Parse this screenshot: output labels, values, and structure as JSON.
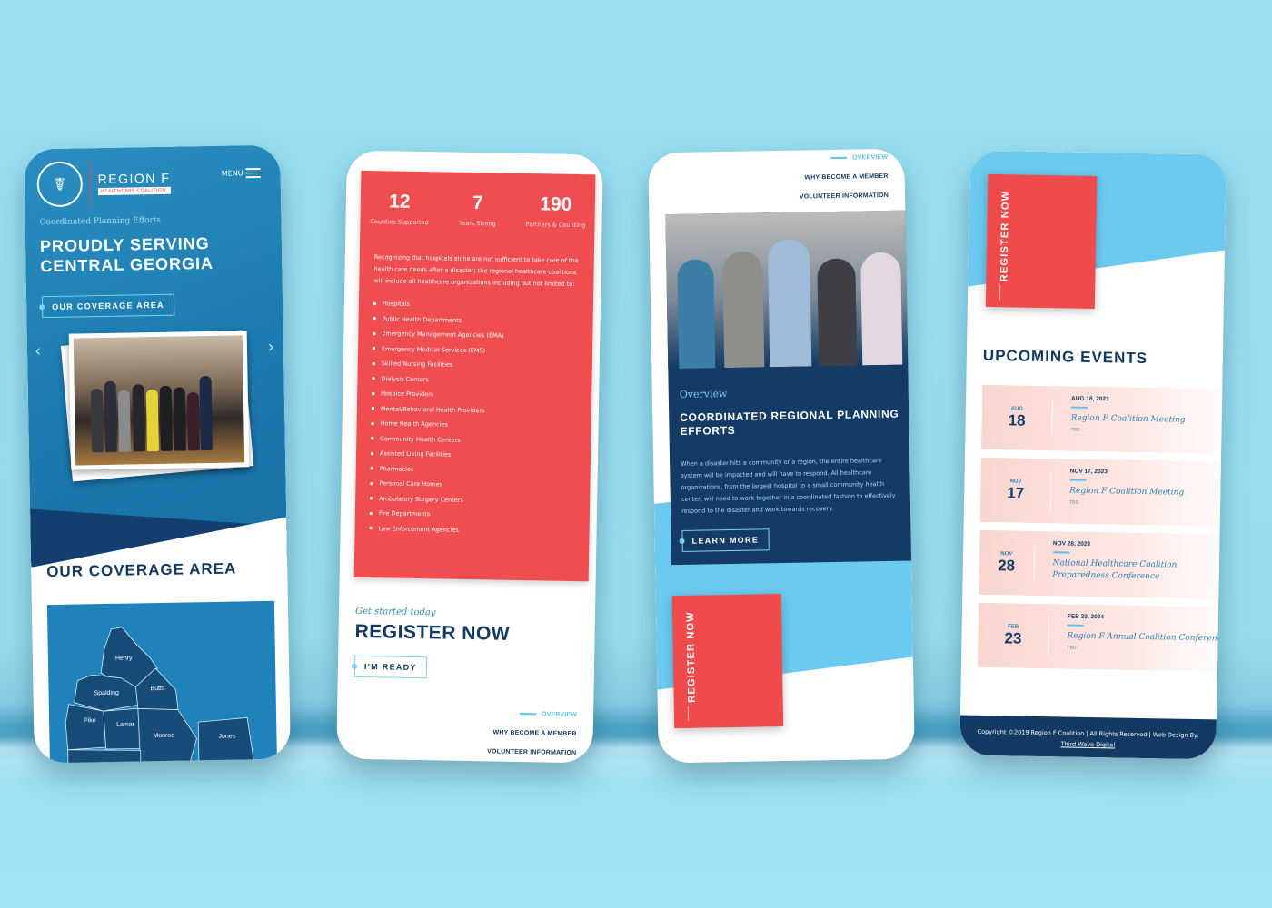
{
  "phone1": {
    "logo": {
      "title": "REGION F",
      "subtitle": "HEALTHCARE COALITION"
    },
    "menu_label": "MENU",
    "hero": {
      "eyebrow": "Coordinated Planning Efforts",
      "title_line1": "PROUDLY SERVING",
      "title_line2": "CENTRAL GEORGIA",
      "cta": "OUR COVERAGE AREA"
    },
    "carousel": {
      "prev": "‹",
      "next": "›"
    },
    "coverage": {
      "title": "OUR COVERAGE AREA",
      "counties": [
        "Henry",
        "Spalding",
        "Butts",
        "Pike",
        "Lamar",
        "Monroe",
        "Jones"
      ]
    }
  },
  "phone2": {
    "stats": [
      {
        "value": "12",
        "label": "Counties Supported"
      },
      {
        "value": "7",
        "label": "Years Strong"
      },
      {
        "value": "190",
        "label": "Partners & Counting"
      }
    ],
    "intro": "Recognizing that hospitals alone are not sufficient to take care of the health care needs after a disaster; the regional healthcare coalitions will include all healthcare organizations including but not limited to:",
    "organizations": [
      "Hospitals",
      "Public Health Departments",
      "Emergency Management Agencies (EMA)",
      "Emergency Medical Services (EMS)",
      "Skilled Nursing Facilities",
      "Dialysis Centers",
      "Hospice Providers",
      "Mental/Behavioral Health Providers",
      "Home Health Agencies",
      "Community Health Centers",
      "Assisted Living Facilities",
      "Pharmacies",
      "Personal Care Homes",
      "Ambulatory Surgery Centers",
      "Fire Departments",
      "Law Enforcement Agencies"
    ],
    "register": {
      "eyebrow": "Get started today",
      "title": "REGISTER NOW",
      "cta": "I'M READY"
    },
    "subnav": [
      "OVERVIEW",
      "WHY BECOME A MEMBER",
      "VOLUNTEER INFORMATION"
    ]
  },
  "phone3": {
    "subnav": [
      "OVERVIEW",
      "WHY BECOME A MEMBER",
      "VOLUNTEER INFORMATION"
    ],
    "overview": {
      "eyebrow": "Overview",
      "title": "COORDINATED REGIONAL PLANNING EFFORTS",
      "body": "When a disaster hits a community or a region, the entire healthcare system will be impacted and will have to respond. All healthcare organizations, from the largest hospital to a small community health center, will need to work together in a coordinated fashion to effectively respond to the disaster and work towards recovery.",
      "cta": "LEARN MORE"
    },
    "register_tile": "REGISTER NOW"
  },
  "phone4": {
    "register_tile": "REGISTER NOW",
    "events_title": "UPCOMING EVENTS",
    "events": [
      {
        "month": "AUG",
        "day": "18",
        "date": "AUG 18, 2023",
        "name": "Region F Coalition Meeting",
        "location": "TBD"
      },
      {
        "month": "NOV",
        "day": "17",
        "date": "NOV 17, 2023",
        "name": "Region F Coalition Meeting",
        "location": "TBD"
      },
      {
        "month": "NOV",
        "day": "28",
        "date": "NOV 28, 2023",
        "name": "National Healthcare Coalition Preparedness Conference",
        "location": ""
      },
      {
        "month": "FEB",
        "day": "23",
        "date": "FEB 23, 2024",
        "name": "Region F Annual Coalition Conference",
        "location": "TBD"
      }
    ],
    "footer": {
      "text": "Copyright ©2019 Region F Coalition | All Rights Reserved | Web Design By:",
      "link": "Third Wave Digital"
    }
  },
  "colors": {
    "primary_blue": "#1c7bb0",
    "navy": "#123a63",
    "accent_red": "#ef4d4f",
    "light_blue": "#6cc9ef",
    "background": "#9be0f2"
  }
}
